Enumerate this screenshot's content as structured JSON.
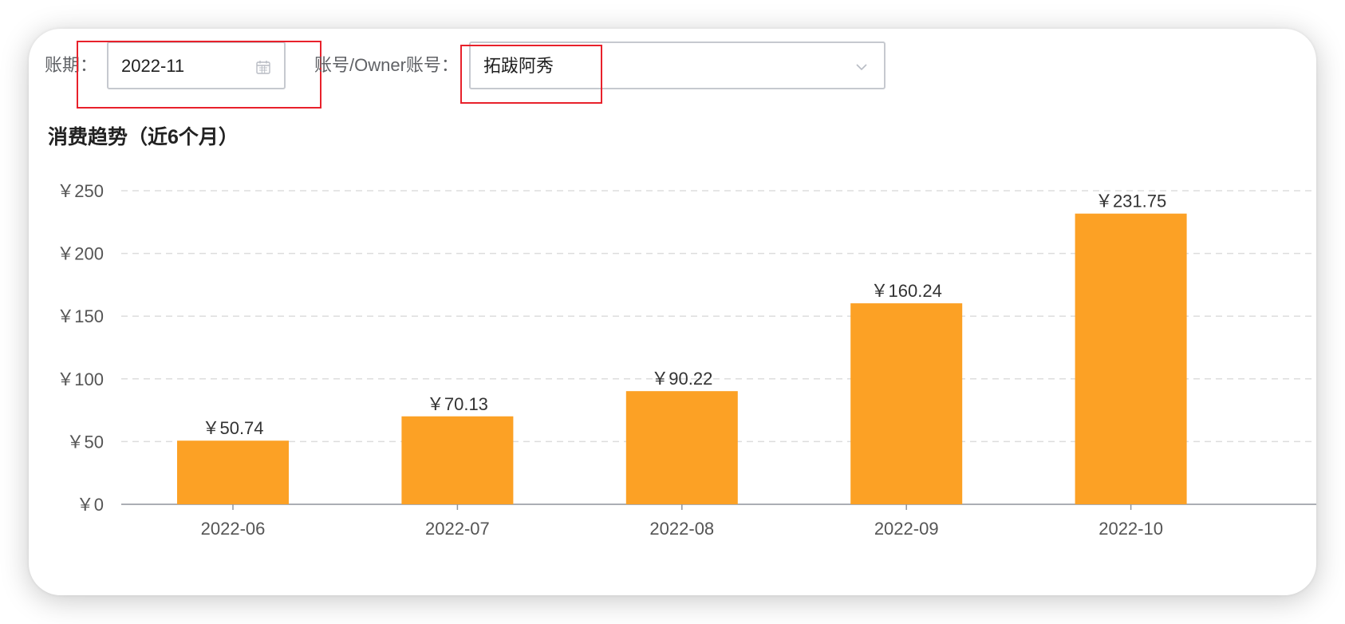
{
  "filters": {
    "period_label": "账期：",
    "period_value": "2022-11",
    "account_label": "账号/Owner账号：",
    "account_value": "拓跋阿秀"
  },
  "section": {
    "title": "消费趋势（近6个月）"
  },
  "icons": {
    "calendar": "calendar-icon",
    "dropdown": "chevron-down-icon"
  },
  "colors": {
    "bar": "#fca125",
    "highlight": "#e8212b",
    "grid": "#dddddd",
    "axis_text": "#555555"
  },
  "chart_data": {
    "type": "bar",
    "categories": [
      "2022-06",
      "2022-07",
      "2022-08",
      "2022-09",
      "2022-10"
    ],
    "values": [
      50.74,
      70.13,
      90.22,
      160.24,
      231.75
    ],
    "value_labels": [
      "￥50.74",
      "￥70.13",
      "￥90.22",
      "￥160.24",
      "￥231.75"
    ],
    "y_ticks": [
      0,
      50,
      100,
      150,
      200,
      250
    ],
    "y_tick_labels": [
      "￥0",
      "￥50",
      "￥100",
      "￥150",
      "￥200",
      "￥250"
    ],
    "ylim": [
      0,
      250
    ],
    "grid": true,
    "legend": "none"
  }
}
